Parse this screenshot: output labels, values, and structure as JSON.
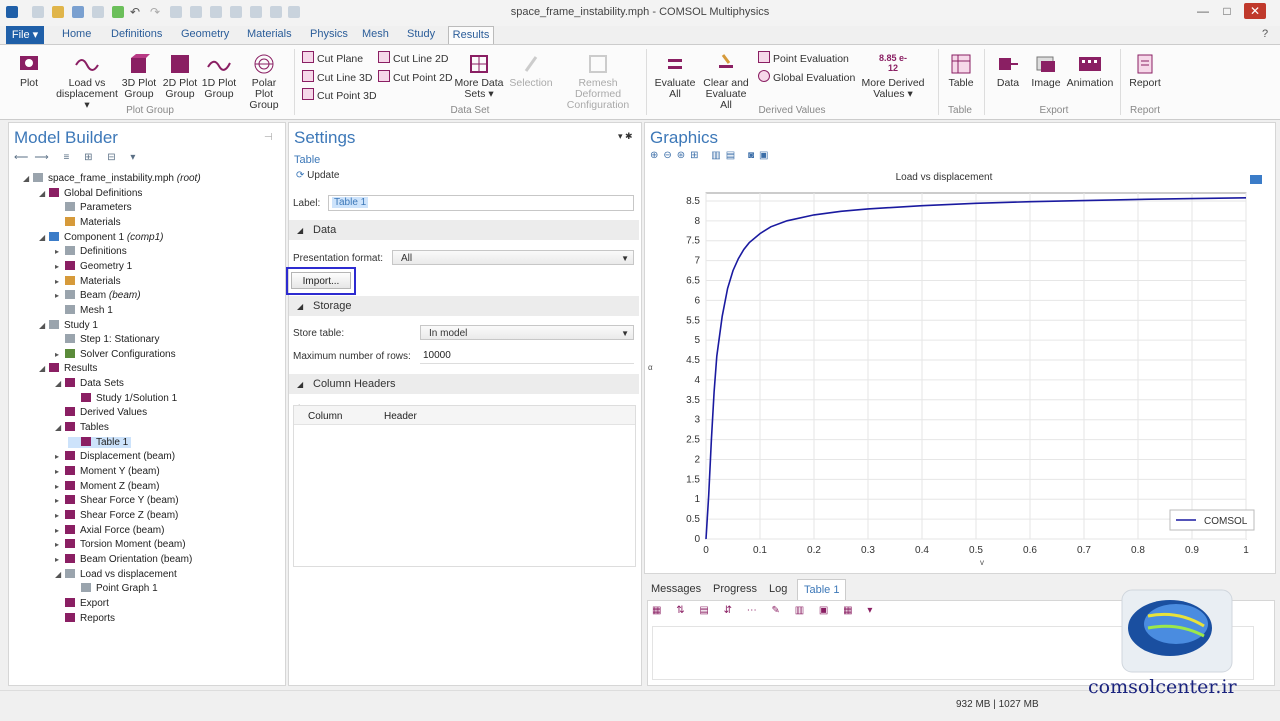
{
  "window": {
    "title": "space_frame_instability.mph - COMSOL Multiphysics",
    "min": "—",
    "max": "□",
    "close": "✕"
  },
  "tabs": {
    "file": "File ▾",
    "items": [
      "Home",
      "Definitions",
      "Geometry",
      "Materials",
      "Physics",
      "Mesh",
      "Study"
    ],
    "active": "Results"
  },
  "ribbon": {
    "plot": "Plot",
    "load_vs_disp": "Load vs displacement ▾",
    "plot3d": "3D Plot Group",
    "plot2d": "2D Plot Group",
    "plot1d": "1D Plot Group",
    "polar": "Polar Plot Group",
    "group_plot": "Plot Group",
    "cut_plane": "Cut Plane",
    "cut_line_3d": "Cut Line 3D",
    "cut_point_3d": "Cut Point 3D",
    "cut_line_2d": "Cut Line 2D",
    "cut_point_2d": "Cut Point 2D",
    "more_datasets": "More Data Sets ▾",
    "group_dataset": "Data Set",
    "selection": "Selection",
    "remesh": "Remesh Deformed Configuration",
    "evaluate_all": "Evaluate All",
    "clear_eval": "Clear and Evaluate All",
    "point_eval": "Point Evaluation",
    "global_eval": "Global Evaluation",
    "more_derived": "More Derived Values ▾",
    "group_derived": "Derived Values",
    "table": "Table",
    "group_table": "Table",
    "data": "Data",
    "image": "Image",
    "animation": "Animation",
    "group_export": "Export",
    "report": "Report",
    "group_report": "Report",
    "number_icon": "8.85 e-12"
  },
  "model_builder": {
    "title": "Model Builder",
    "tree": [
      {
        "label": "space_frame_instability.mph",
        "suffix": " (root)",
        "level": 0,
        "icon": "gy",
        "exp": "◢"
      },
      {
        "label": "Global Definitions",
        "suffix": "",
        "level": 1,
        "icon": "pm",
        "exp": "◢"
      },
      {
        "label": "Parameters",
        "suffix": "",
        "level": 2,
        "icon": "gy",
        "exp": ""
      },
      {
        "label": "Materials",
        "suffix": "",
        "level": 2,
        "icon": "tn",
        "exp": ""
      },
      {
        "label": "Component 1",
        "suffix": " (comp1)",
        "level": 1,
        "icon": "bl",
        "exp": "◢"
      },
      {
        "label": "Definitions",
        "suffix": "",
        "level": 2,
        "icon": "gy",
        "exp": "▸"
      },
      {
        "label": "Geometry 1",
        "suffix": "",
        "level": 2,
        "icon": "pm",
        "exp": "▸"
      },
      {
        "label": "Materials",
        "suffix": "",
        "level": 2,
        "icon": "tn",
        "exp": "▸"
      },
      {
        "label": "Beam",
        "suffix": " (beam)",
        "level": 2,
        "icon": "gy",
        "exp": "▸"
      },
      {
        "label": "Mesh 1",
        "suffix": "",
        "level": 2,
        "icon": "gy",
        "exp": ""
      },
      {
        "label": "Study 1",
        "suffix": "",
        "level": 1,
        "icon": "gy",
        "exp": "◢"
      },
      {
        "label": "Step 1: Stationary",
        "suffix": "",
        "level": 2,
        "icon": "gy",
        "exp": ""
      },
      {
        "label": "Solver Configurations",
        "suffix": "",
        "level": 2,
        "icon": "gn",
        "exp": "▸"
      },
      {
        "label": "Results",
        "suffix": "",
        "level": 1,
        "icon": "pm",
        "exp": "◢"
      },
      {
        "label": "Data Sets",
        "suffix": "",
        "level": 2,
        "icon": "pm",
        "exp": "◢"
      },
      {
        "label": "Study 1/Solution 1",
        "suffix": "",
        "level": 3,
        "icon": "pm",
        "exp": ""
      },
      {
        "label": "Derived Values",
        "suffix": "",
        "level": 2,
        "icon": "pm",
        "exp": ""
      },
      {
        "label": "Tables",
        "suffix": "",
        "level": 2,
        "icon": "pm",
        "exp": "◢"
      },
      {
        "label": "Table 1",
        "suffix": "",
        "level": 3,
        "icon": "pm",
        "exp": "",
        "selected": true
      },
      {
        "label": "Displacement (beam)",
        "suffix": "",
        "level": 2,
        "icon": "pm",
        "exp": "▸"
      },
      {
        "label": "Moment Y (beam)",
        "suffix": "",
        "level": 2,
        "icon": "pm",
        "exp": "▸"
      },
      {
        "label": "Moment Z (beam)",
        "suffix": "",
        "level": 2,
        "icon": "pm",
        "exp": "▸"
      },
      {
        "label": "Shear Force Y (beam)",
        "suffix": "",
        "level": 2,
        "icon": "pm",
        "exp": "▸"
      },
      {
        "label": "Shear Force Z (beam)",
        "suffix": "",
        "level": 2,
        "icon": "pm",
        "exp": "▸"
      },
      {
        "label": "Axial Force (beam)",
        "suffix": "",
        "level": 2,
        "icon": "pm",
        "exp": "▸"
      },
      {
        "label": "Torsion Moment (beam)",
        "suffix": "",
        "level": 2,
        "icon": "pm",
        "exp": "▸"
      },
      {
        "label": "Beam Orientation (beam)",
        "suffix": "",
        "level": 2,
        "icon": "pm",
        "exp": "▸"
      },
      {
        "label": "Load vs displacement",
        "suffix": "",
        "level": 2,
        "icon": "gy",
        "exp": "◢"
      },
      {
        "label": "Point Graph 1",
        "suffix": "",
        "level": 3,
        "icon": "gy",
        "exp": ""
      },
      {
        "label": "Export",
        "suffix": "",
        "level": 2,
        "icon": "pm",
        "exp": ""
      },
      {
        "label": "Reports",
        "suffix": "",
        "level": 2,
        "icon": "pm",
        "exp": ""
      }
    ]
  },
  "settings": {
    "title": "Settings",
    "subtitle": "Table",
    "update": "Update",
    "label_caption": "Label:",
    "label_value": "Table 1",
    "data_section": "Data",
    "presentation_caption": "Presentation format:",
    "presentation_value": "All",
    "import_button": "Import...",
    "storage_section": "Storage",
    "store_caption": "Store table:",
    "store_value": "In model",
    "maxrows_caption": "Maximum number of rows:",
    "maxrows_value": "10000",
    "colheaders_section": "Column Headers",
    "col_header": "Column",
    "header_header": "Header",
    "toolbar_marker": "↕"
  },
  "graphics": {
    "title": "Graphics",
    "legend": "COMSOL",
    "y_axis_glyph": "α",
    "x_axis_glyph": "v"
  },
  "chart_data": {
    "type": "line",
    "title": "Load vs displacement",
    "xlim": [
      0,
      1.0
    ],
    "ylim": [
      0,
      8.7
    ],
    "xticks": [
      "0",
      "0.1",
      "0.2",
      "0.3",
      "0.4",
      "0.5",
      "0.6",
      "0.7",
      "0.8",
      "0.9",
      "1"
    ],
    "yticks": [
      "0",
      "0.5",
      "1",
      "1.5",
      "2",
      "2.5",
      "3",
      "3.5",
      "4",
      "4.5",
      "5",
      "5.5",
      "6",
      "6.5",
      "7",
      "7.5",
      "8",
      "8.5"
    ],
    "series": [
      {
        "name": "COMSOL",
        "color": "#1a1aa0",
        "x": [
          0,
          0.005,
          0.01,
          0.015,
          0.02,
          0.03,
          0.04,
          0.05,
          0.06,
          0.07,
          0.08,
          0.1,
          0.12,
          0.15,
          0.2,
          0.25,
          0.3,
          0.4,
          0.5,
          0.6,
          0.7,
          0.8,
          0.9,
          1.0
        ],
        "y": [
          0,
          1.1,
          2.5,
          3.7,
          4.6,
          5.6,
          6.3,
          6.75,
          7.05,
          7.28,
          7.45,
          7.68,
          7.85,
          8.0,
          8.15,
          8.24,
          8.3,
          8.38,
          8.44,
          8.48,
          8.51,
          8.54,
          8.56,
          8.58
        ]
      }
    ]
  },
  "bottom_panel": {
    "tabs": [
      "Messages",
      "Progress",
      "Log",
      "Table 1"
    ]
  },
  "status": {
    "memory": "932 MB | 1027 MB",
    "watermark": "comsolcenter.ir"
  }
}
